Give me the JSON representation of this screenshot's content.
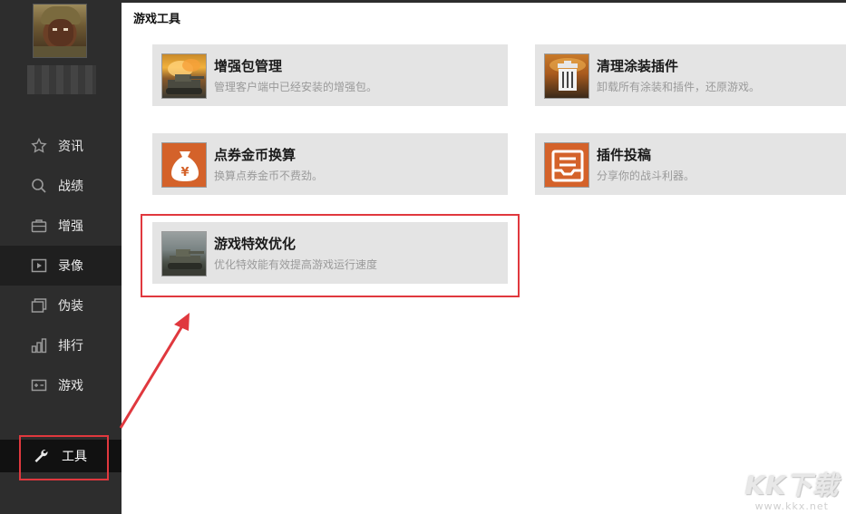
{
  "sidebar": {
    "items": [
      {
        "label": "资讯",
        "icon": "star-icon"
      },
      {
        "label": "战绩",
        "icon": "search-icon"
      },
      {
        "label": "增强",
        "icon": "briefcase-icon"
      },
      {
        "label": "录像",
        "icon": "play-icon"
      },
      {
        "label": "伪装",
        "icon": "layers-icon"
      },
      {
        "label": "排行",
        "icon": "bar-chart-icon"
      },
      {
        "label": "游戏",
        "icon": "gamepad-icon"
      }
    ],
    "active_item": "录像",
    "tools_label": "工具",
    "tools_icon": "wrench-icon"
  },
  "main": {
    "title": "游戏工具",
    "cards": [
      {
        "title": "增强包管理",
        "desc": "管理客户端中已经安装的增强包。",
        "icon": "burning-tank-image"
      },
      {
        "title": "清理涂装插件",
        "desc": "卸载所有涂装和插件，还原游戏。",
        "icon": "trash-can-image"
      },
      {
        "title": "点券金币换算",
        "desc": "换算点券金币不费劲。",
        "icon": "money-bag-icon"
      },
      {
        "title": "插件投稿",
        "desc": "分享你的战斗利器。",
        "icon": "inbox-tray-icon"
      },
      {
        "title": "游戏特效优化",
        "desc": "优化特效能有效提高游戏运行速度",
        "icon": "tank-image"
      }
    ]
  },
  "watermark": {
    "logo": "KK下载",
    "url": "www.kkx.net"
  },
  "colors": {
    "sidebar_bg": "#2d2d2d",
    "card_bg": "#e4e4e4",
    "highlight_red": "#e0383e",
    "tile_orange": "#d4622a"
  }
}
